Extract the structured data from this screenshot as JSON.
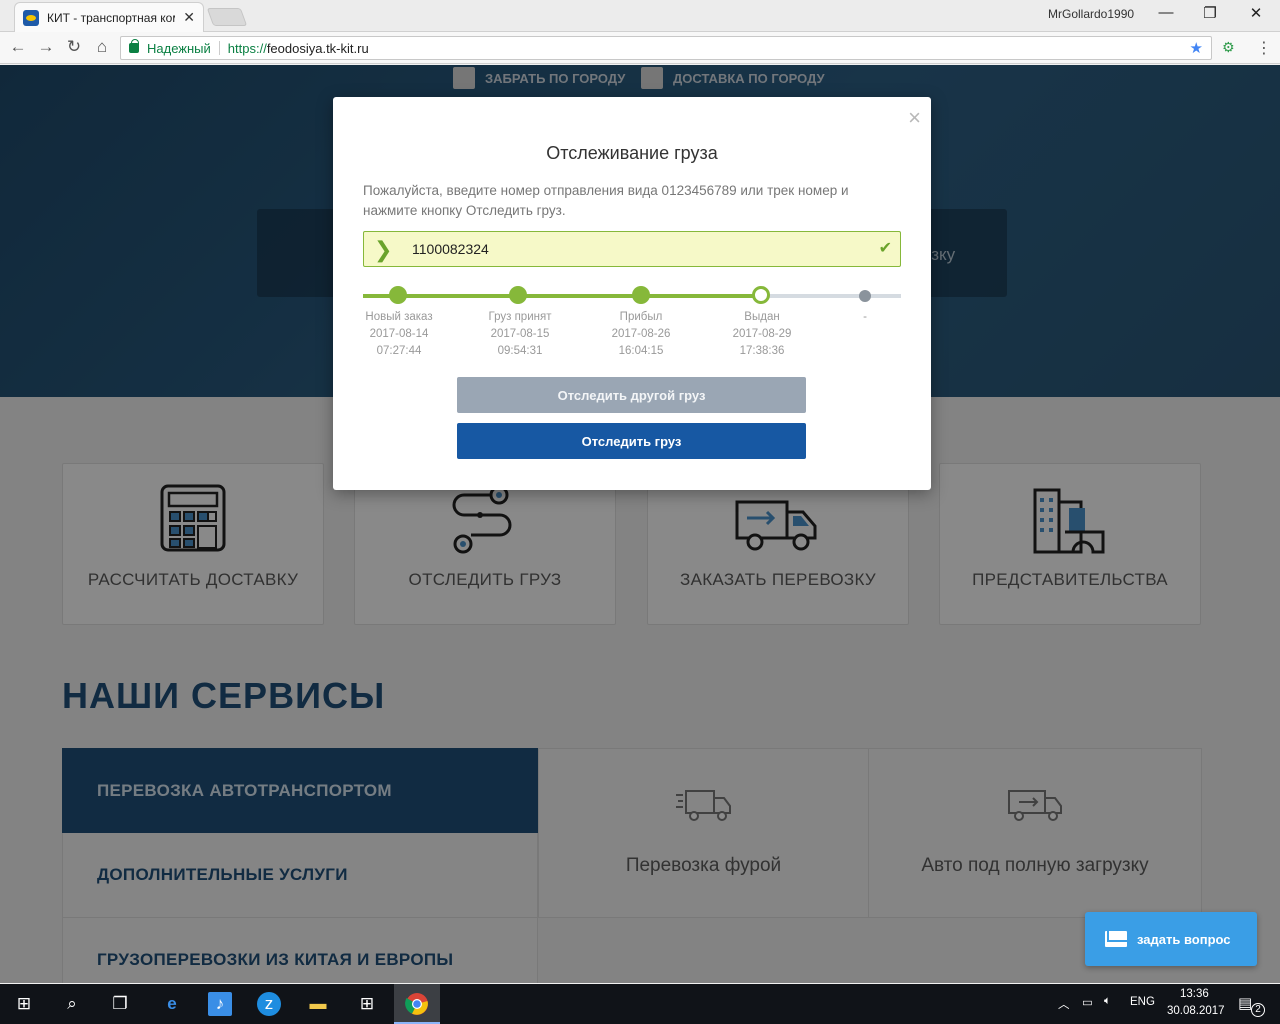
{
  "browser": {
    "tab_title": "КИТ - транспортная ком",
    "tab_close": "✕",
    "user": "MrGollardo1990",
    "secure_label": "Надежный",
    "url_proto": "https://",
    "url_host": "feodosiya.tk-kit.ru"
  },
  "hero": {
    "check_pickup": "ЗАБРАТЬ ПО ГОРОДУ",
    "check_delivery": "ДОСТАВКА ПО ГОРОДУ",
    "tile_right_text": "озку"
  },
  "cards": [
    {
      "label": "РАССЧИТАТЬ ДОСТАВКУ",
      "icon": "calculator-icon"
    },
    {
      "label": "ОТСЛЕДИТЬ ГРУЗ",
      "icon": "route-icon"
    },
    {
      "label": "ЗАКАЗАТЬ ПЕРЕВОЗКУ",
      "icon": "truck-icon"
    },
    {
      "label": "ПРЕДСТАВИТЕЛЬСТВА",
      "icon": "buildings-icon"
    }
  ],
  "services": {
    "title": "НАШИ СЕРВИСЫ",
    "menu": [
      "ПЕРЕВОЗКА АВТОТРАНСПОРТОМ",
      "ДОПОЛНИТЕЛЬНЫЕ УСЛУГИ",
      "ГРУЗОПЕРЕВОЗКИ ИЗ КИТАЯ И ЕВРОПЫ"
    ],
    "panels": [
      "Перевозка фурой",
      "Авто под полную загрузку"
    ]
  },
  "ask_button": "задать вопрос",
  "modal": {
    "close": "×",
    "title": "Отслеживание груза",
    "hint": "Пожалуйста, введите номер отправления вида 0123456789 или трек номер и нажмите кнопку Отследить груз.",
    "track_value": "1100082324",
    "steps": [
      {
        "name": "Новый заказ",
        "date": "2017-08-14",
        "time": "07:27:44",
        "state": "done"
      },
      {
        "name": "Груз принят",
        "date": "2017-08-15",
        "time": "09:54:31",
        "state": "done"
      },
      {
        "name": "Прибыл",
        "date": "2017-08-26",
        "time": "16:04:15",
        "state": "done"
      },
      {
        "name": "Выдан",
        "date": "2017-08-29",
        "time": "17:38:36",
        "state": "current"
      },
      {
        "name": "-",
        "date": "",
        "time": "",
        "state": "pending"
      }
    ],
    "btn_other": "Отследить другой груз",
    "btn_track": "Отследить груз"
  },
  "colors": {
    "brand_blue": "#1f4f78",
    "button_blue": "#1758a3",
    "progress_green": "#86b83a"
  },
  "taskbar": {
    "lang": "ENG",
    "time": "13:36",
    "date": "30.08.2017",
    "notifications": "2"
  }
}
